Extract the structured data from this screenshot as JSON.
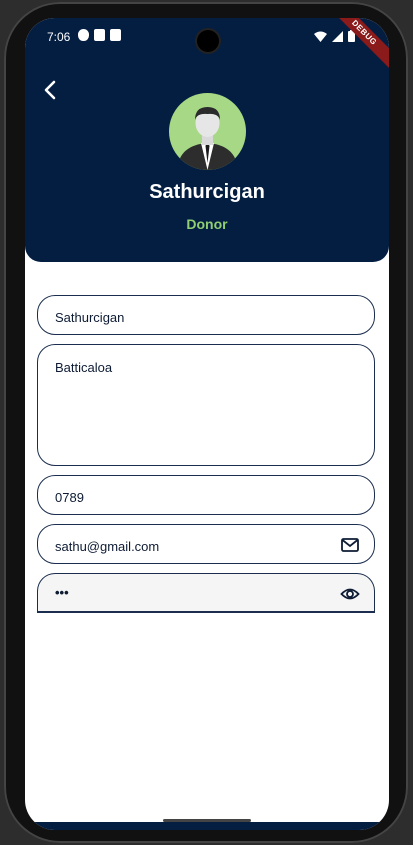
{
  "statusbar": {
    "time": "7:06"
  },
  "debug_banner": "DEBUG",
  "profile": {
    "name": "Sathurcigan",
    "role": "Donor"
  },
  "form": {
    "name_value": "Sathurcigan",
    "address_value": "Batticaloa",
    "phone_value": "0789",
    "email_value": "sathu@gmail.com",
    "password_value": "•••"
  },
  "colors": {
    "header_bg": "#041e42",
    "accent_green": "#8fcf72",
    "avatar_bg": "#a6d885"
  },
  "icons": {
    "back": "back-arrow-icon",
    "email": "mail-icon",
    "password": "eye-icon"
  }
}
